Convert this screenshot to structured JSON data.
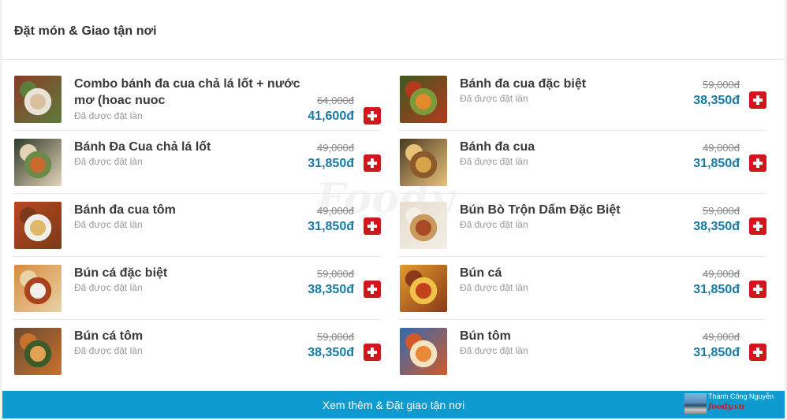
{
  "header": {
    "title": "Đặt món & Giao tận nơi"
  },
  "watermark": {
    "text": "Foody",
    "suffix": ".vn"
  },
  "ordered_label": "Đã được đặt lần",
  "left_items": [
    {
      "name": "Combo bánh đa cua chả lá lốt + nước mơ (hoac nuoc",
      "old_price": "64,000đ",
      "new_price": "41,600đ",
      "palette": [
        "#8b3a2a",
        "#d9c1a0",
        "#e8e3d8",
        "#5d7d3a"
      ]
    },
    {
      "name": "Bánh Đa Cua chả lá lốt",
      "old_price": "49,000đ",
      "new_price": "31,850đ",
      "palette": [
        "#2f3b2c",
        "#c8692e",
        "#6b8a4a",
        "#e3d4b8"
      ]
    },
    {
      "name": "Bánh đa cua tôm",
      "old_price": "49,000đ",
      "new_price": "31,850đ",
      "palette": [
        "#b8481f",
        "#e0b86a",
        "#f2f0ea",
        "#7a3a1a"
      ]
    },
    {
      "name": "Bún cá đặc biệt",
      "old_price": "59,000đ",
      "new_price": "38,350đ",
      "palette": [
        "#d98a3c",
        "#f4f1ea",
        "#a8431e",
        "#e8d2a8"
      ]
    },
    {
      "name": "Bún cá tôm",
      "old_price": "59,000đ",
      "new_price": "38,350đ",
      "palette": [
        "#6a4a30",
        "#e2a253",
        "#3d5a2a",
        "#c9722e"
      ]
    }
  ],
  "right_items": [
    {
      "name": "Bánh đa cua đặc biệt",
      "old_price": "59,000đ",
      "new_price": "38,350đ",
      "palette": [
        "#3c5a23",
        "#e08a2c",
        "#7d9a3a",
        "#b5391c"
      ]
    },
    {
      "name": "Bánh đa cua",
      "old_price": "49,000đ",
      "new_price": "31,850đ",
      "palette": [
        "#4a3a22",
        "#d7a44a",
        "#8a5a2a",
        "#e9c27a"
      ]
    },
    {
      "name": "Bún Bò Trộn Dấm Đặc Biệt",
      "old_price": "59,000đ",
      "new_price": "38,350đ",
      "palette": [
        "#e6ddcf",
        "#a84a24",
        "#c99a5e",
        "#f3efe6"
      ]
    },
    {
      "name": "Bún cá",
      "old_price": "49,000đ",
      "new_price": "31,850đ",
      "palette": [
        "#e39a2c",
        "#c2421c",
        "#f0c24a",
        "#8a3a18"
      ]
    },
    {
      "name": "Bún tôm",
      "old_price": "49,000đ",
      "new_price": "31,850đ",
      "palette": [
        "#2f6ab3",
        "#e88a3a",
        "#f3e3c0",
        "#d25a2a"
      ]
    }
  ],
  "footer": {
    "button_label": "Xem thêm & Đặt giao tận nơi"
  },
  "credit": {
    "name": "Thành Công Nguyễn",
    "logo": "foody.vn"
  },
  "colors": {
    "accent": "#0e9bd0",
    "price": "#1679a8",
    "add_button": "#d2161e"
  }
}
